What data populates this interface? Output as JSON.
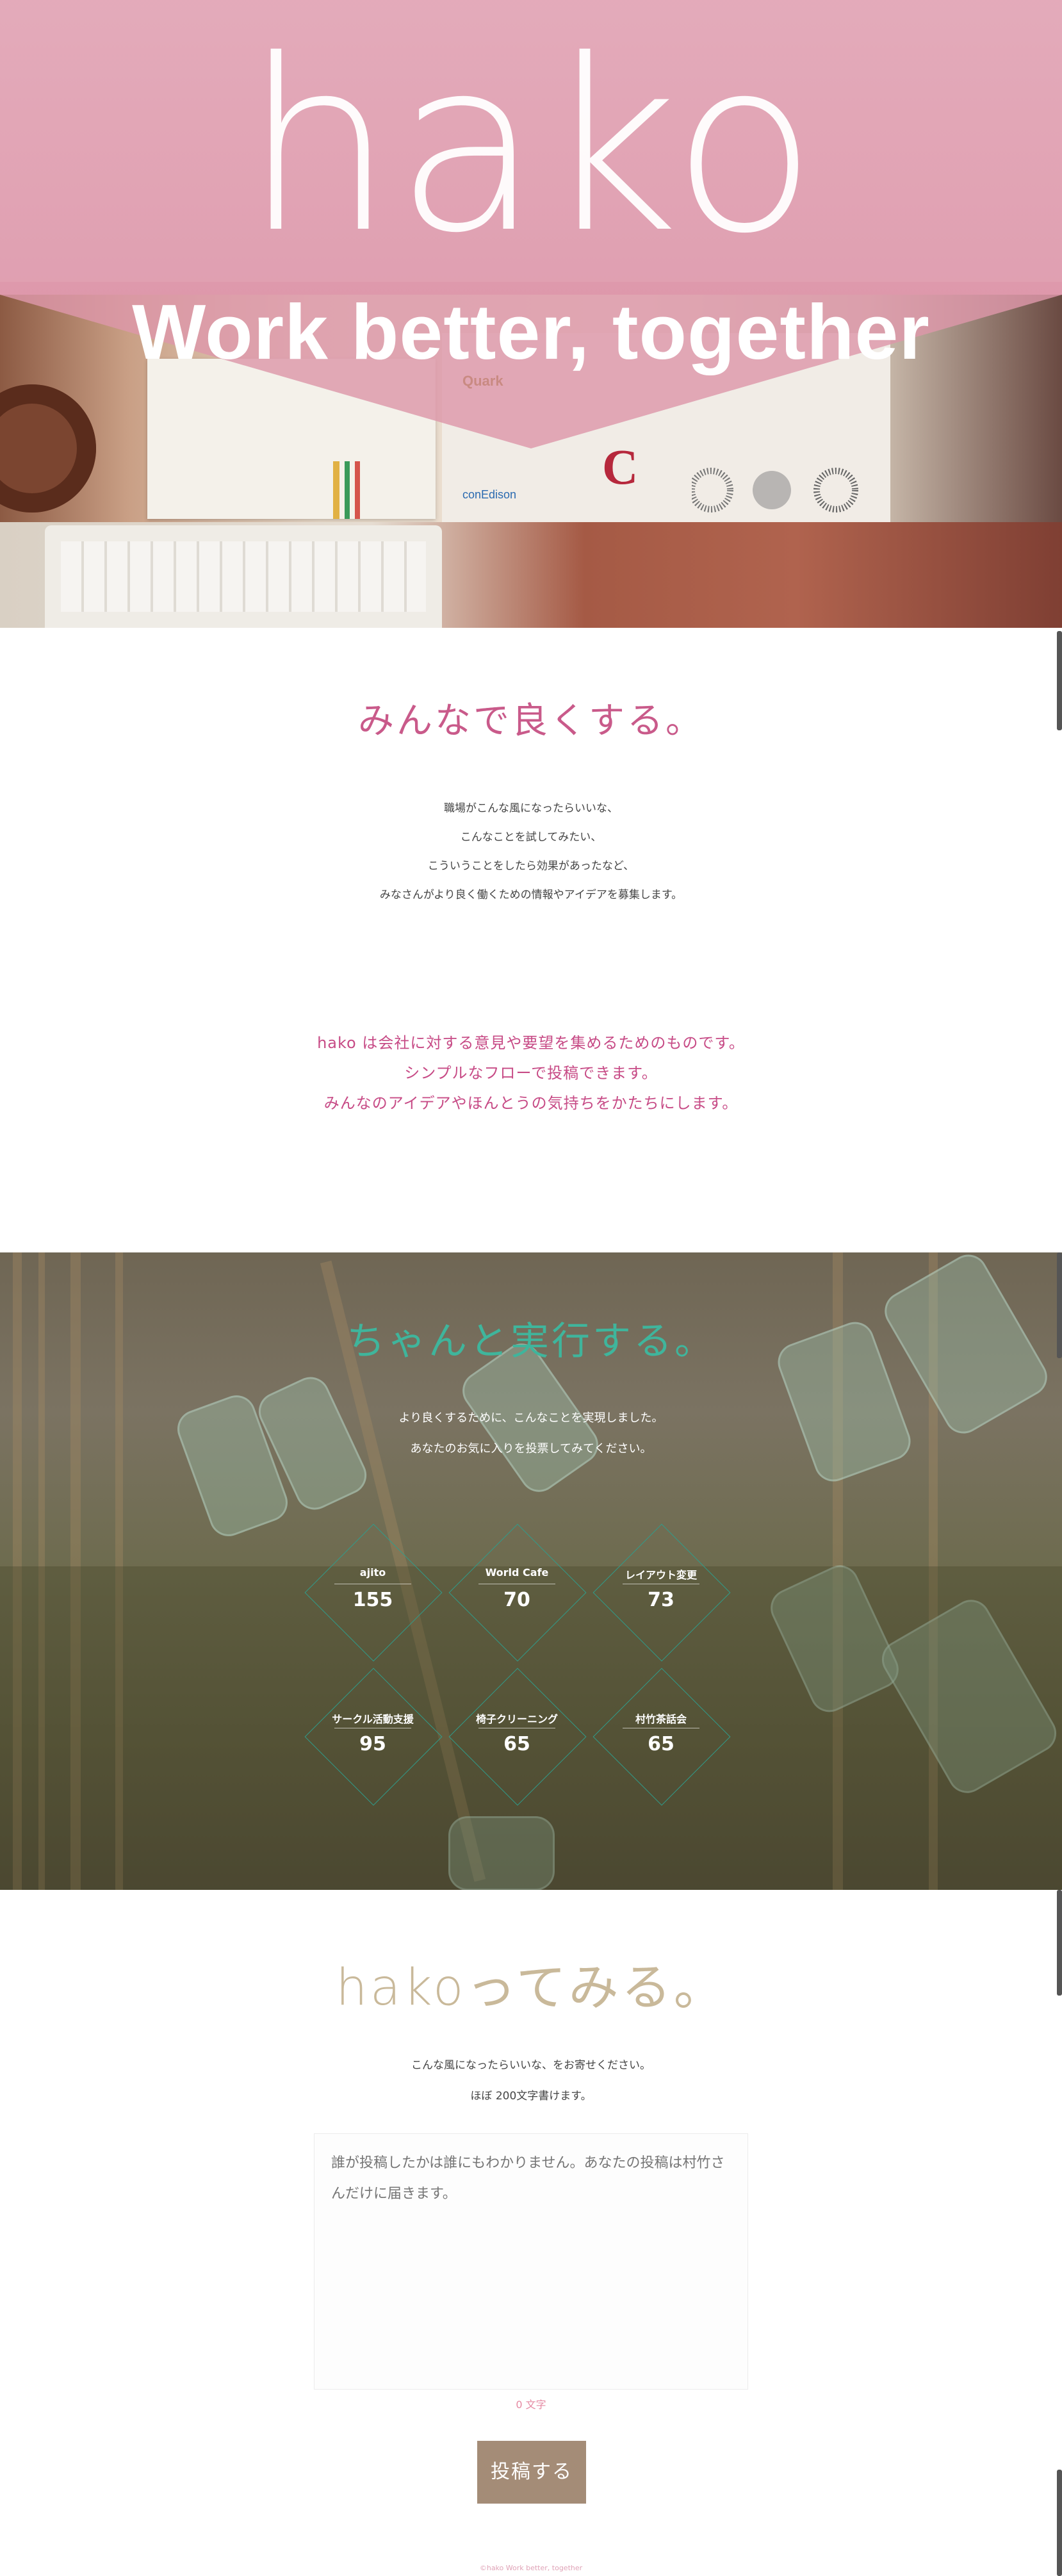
{
  "hero": {
    "title": "hako",
    "tagline": "Work better, together",
    "brand_logos": [
      "Quark",
      "conEdison"
    ]
  },
  "intro": {
    "heading": "みんなで良くする。",
    "lines": [
      "職場がこんな風になったらいいな、",
      "こんなことを試してみたい、",
      "こういうことをしたら効果があったなど、",
      "みなさんがより良く働くための情報やアイデアを募集します。"
    ],
    "pink_lines": [
      "hako は会社に対する意見や要望を集めるためのものです。",
      "シンプルなフローで投稿できます。",
      "みんなのアイデアやほんとうの気持ちをかたちにします。"
    ]
  },
  "execute": {
    "heading": "ちゃんと実行する。",
    "lines": [
      "より良くするために、こんなことを実現しました。",
      "あなたのお気に入りを投票してみてください。"
    ],
    "items": [
      {
        "label": "ajito",
        "count": "155"
      },
      {
        "label": "World Cafe",
        "count": "70"
      },
      {
        "label": "レイアウト変更",
        "count": "73"
      },
      {
        "label": "サークル活動支援",
        "count": "95"
      },
      {
        "label": "椅子クリーニング",
        "count": "65"
      },
      {
        "label": "村竹茶話会",
        "count": "65"
      }
    ]
  },
  "post": {
    "heading": "hakoってみる。",
    "lines": [
      "こんな風になったらいいな、をお寄せください。",
      "ほぼ 200文字書けます。"
    ],
    "placeholder": "誰が投稿したかは誰にもわかりません。あなたの投稿は村竹さんだけに届きます。",
    "counter": "0 文字",
    "submit_label": "投稿する"
  },
  "footer": {
    "text": "©hako Work better, together"
  },
  "colors": {
    "pink_overlay": "#e1a3b4",
    "heading_pink": "#c95a8a",
    "heading_teal": "#3fb59c",
    "heading_tan": "#c9b99a",
    "button": "#a48c77"
  }
}
